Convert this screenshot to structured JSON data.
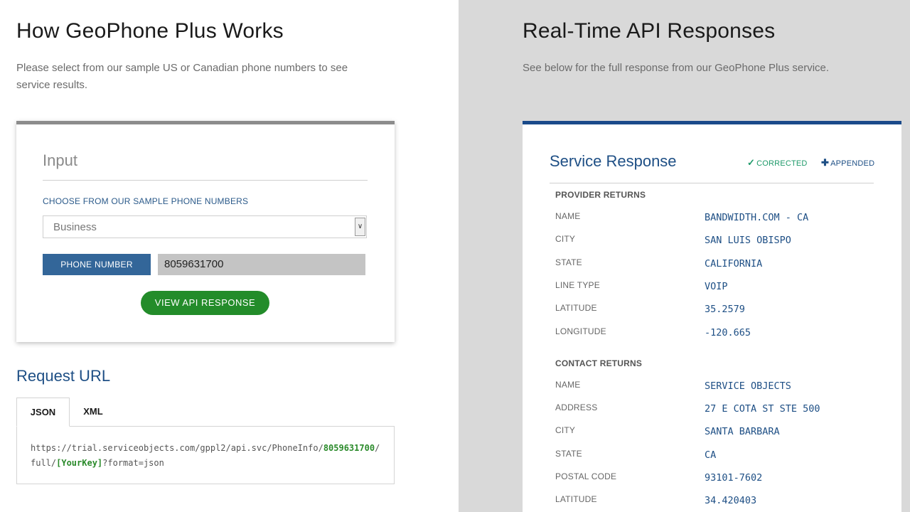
{
  "left": {
    "title": "How GeoPhone Plus Works",
    "subtitle_line1": "Please select from our sample US or Canadian phone numbers to see",
    "subtitle_line2": "service results.",
    "input_card": {
      "title": "Input",
      "choose_label": "CHOOSE FROM OUR SAMPLE PHONE NUMBERS",
      "select_value": "Business",
      "phone_button": "PHONE NUMBER",
      "phone_value": "8059631700",
      "view_button": "VIEW API RESPONSE"
    },
    "request": {
      "title": "Request URL",
      "tabs": [
        "JSON",
        "XML"
      ],
      "url_prefix": "https://trial.serviceobjects.com/gppl2/api.svc/PhoneInfo/",
      "url_phone": "8059631700",
      "url_mid": "/full/",
      "url_key": "[YourKey]",
      "url_suffix": "?format=json"
    }
  },
  "right": {
    "title": "Real-Time API Responses",
    "subtitle": "See below for the full response from our GeoPhone Plus service.",
    "response_card": {
      "title": "Service Response",
      "badge_corrected": "CORRECTED",
      "badge_appended": "APPENDED",
      "provider_heading": "PROVIDER RETURNS",
      "provider_fields": [
        {
          "name": "NAME",
          "value": "BANDWIDTH.COM - CA"
        },
        {
          "name": "CITY",
          "value": "SAN LUIS OBISPO"
        },
        {
          "name": "STATE",
          "value": "CALIFORNIA"
        },
        {
          "name": "LINE TYPE",
          "value": "VOIP"
        },
        {
          "name": "LATITUDE",
          "value": "35.2579"
        },
        {
          "name": "LONGITUDE",
          "value": "-120.665"
        }
      ],
      "contact_heading": "CONTACT RETURNS",
      "contact_fields": [
        {
          "name": "NAME",
          "value": "SERVICE OBJECTS"
        },
        {
          "name": "ADDRESS",
          "value": "27 E COTA ST STE 500"
        },
        {
          "name": "CITY",
          "value": "SANTA BARBARA"
        },
        {
          "name": "STATE",
          "value": "CA"
        },
        {
          "name": "POSTAL CODE",
          "value": "93101-7602"
        },
        {
          "name": "LATITUDE",
          "value": "34.420403"
        }
      ]
    }
  },
  "colors": {
    "accent_blue": "#1e4f85",
    "button_blue": "#336699",
    "button_green": "#238c2a",
    "corrected_green": "#1f9a6a",
    "right_panel_bg": "#d9d9d9"
  }
}
